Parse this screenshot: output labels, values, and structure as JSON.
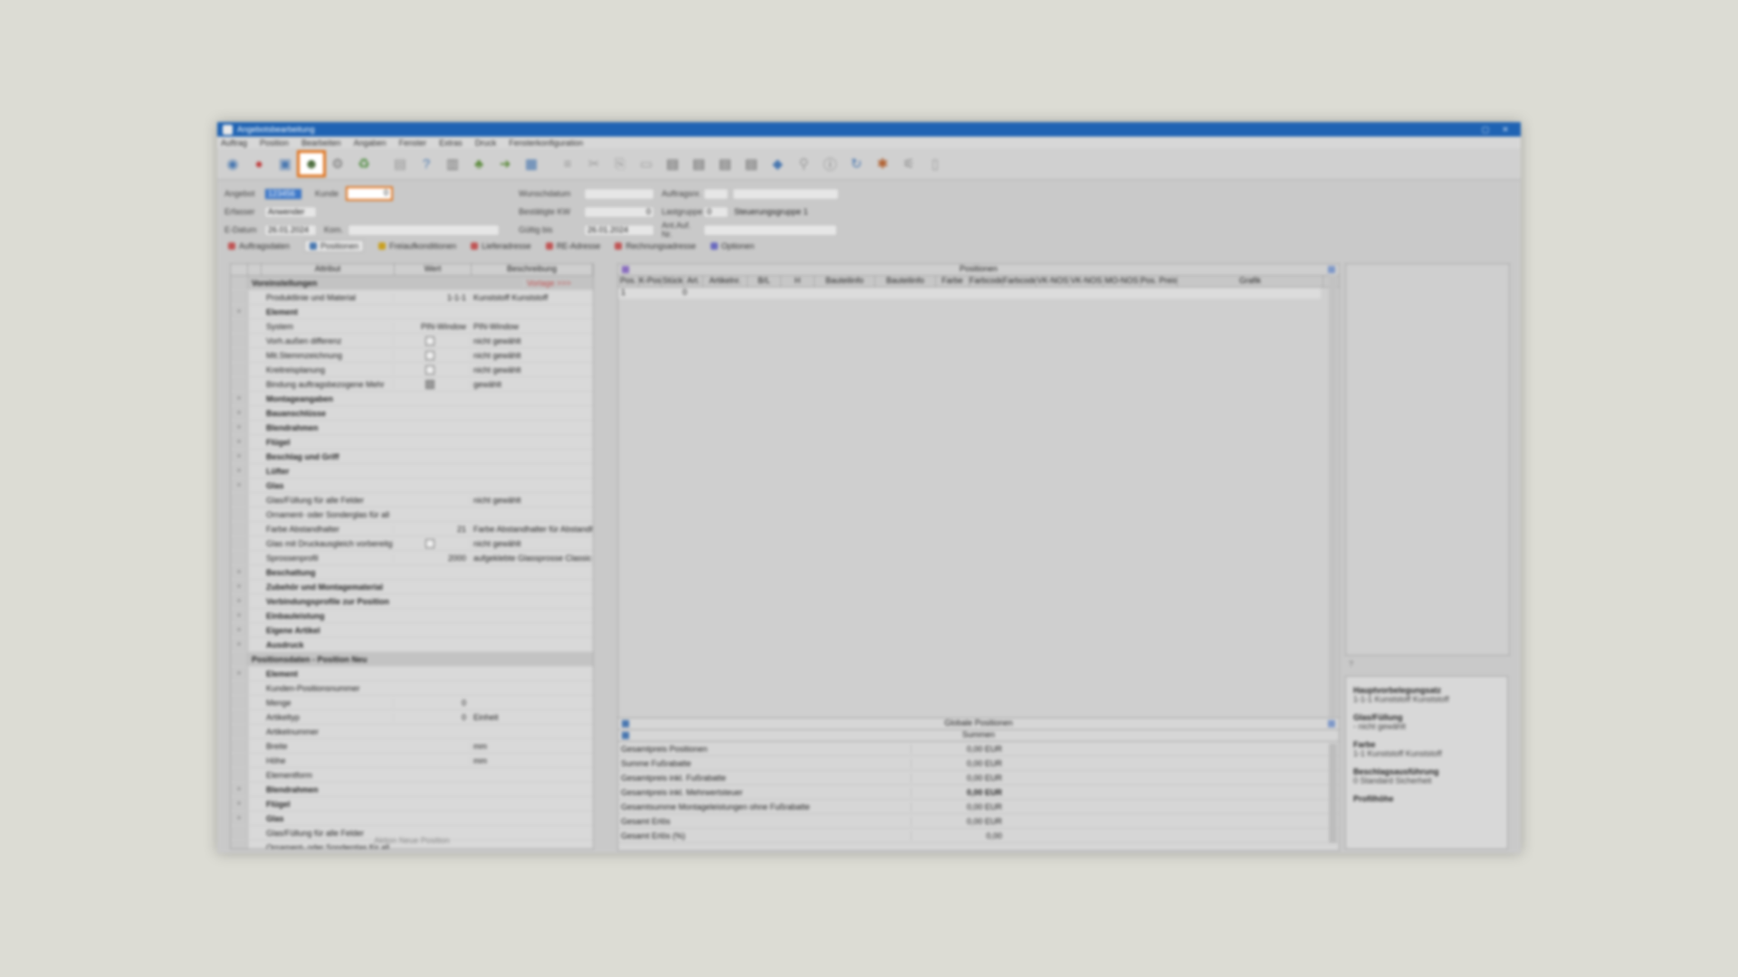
{
  "window": {
    "title": "Angebotsbearbeitung"
  },
  "menu": [
    "Auftrag",
    "Position",
    "Bearbeiten",
    "Angaben",
    "Fenster",
    "Extras",
    "Druck",
    "Fensterkonfiguration"
  ],
  "toolbar": {
    "icons": [
      "globe-icon",
      "stop-icon",
      "save-icon",
      "person-money-icon",
      "gear-icon",
      "recycle-icon",
      "document-icon",
      "help-icon",
      "book-icon",
      "people-icon",
      "arrow-icon",
      "calendar-icon",
      "list-icon",
      "cut-icon",
      "copy-icon",
      "paste-icon",
      "print-icon",
      "print2-icon",
      "print3-icon",
      "print4-icon",
      "globe2-icon",
      "link-icon",
      "info-icon",
      "refresh-icon",
      "tools-icon",
      "filter-icon",
      "document2-icon"
    ]
  },
  "form": {
    "angebot_label": "Angebot",
    "angebot_value": "123456",
    "kunde_label": "Kunde",
    "kunde_value": "0",
    "erfasser_label": "Erfasser",
    "erfasser_value": "Anwender",
    "datum_label": "E-Datum",
    "datum_value": "26.01.2024",
    "kom_label": "Kom.",
    "kom_value": "",
    "wunschdatum_label": "Wunschdatum",
    "wunschdatum_value": "",
    "auftragsnr_label": "Auftragsnr.",
    "auftragsnr_value": "",
    "bestaetigte_label": "Bestätigte KW",
    "bestaetigte_value": "0",
    "lastgruppe_label": "Lastgruppe",
    "lastgruppe_value": "0",
    "lastgruppe_text": "Steuerungsgruppe 1",
    "gueltig_label": "Gültig bis",
    "gueltig_value": "26.01.2024",
    "ansachb_label": "Ant.Auf. Nr.",
    "ansachb_value": ""
  },
  "tabs": [
    "Auftragsdaten",
    "Positionen",
    "Freiaufkonditionen",
    "Lieferadresse",
    "RE-Adresse",
    "Rechnungsadresse",
    "Optionen"
  ],
  "left_table": {
    "headers": [
      "",
      "Attribut",
      "Wert",
      "Beschreibung"
    ],
    "rows": [
      {
        "type": "group",
        "c1": "Voreinstellungen",
        "c2": "",
        "c3": "Vorlage >>>"
      },
      {
        "type": "sub",
        "c1": "Produktlinie und Material",
        "c2": "1-1-1",
        "c3": "Kunststoff Kunststoff"
      },
      {
        "type": "bold",
        "c1": "Element",
        "c2": "",
        "c3": ""
      },
      {
        "type": "sub",
        "c1": "System",
        "c2": "PIN-Window",
        "c3": "PIN-Window"
      },
      {
        "type": "sub",
        "c1": "Vorh.außen differenz",
        "c2": "[cb]",
        "c3": "nicht gewählt"
      },
      {
        "type": "sub",
        "c1": "Mit.Stemmzeichnung",
        "c2": "[cb]",
        "c3": "nicht gewählt"
      },
      {
        "type": "sub",
        "c1": "Kreitreisplanung",
        "c2": "[cb]",
        "c3": "nicht gewählt"
      },
      {
        "type": "sub",
        "c1": "Bindung auftragsbezogene Mehr",
        "c2": "[cbon]",
        "c3": "gewählt"
      },
      {
        "type": "bold",
        "c1": "Montageangaben",
        "c2": "",
        "c3": ""
      },
      {
        "type": "bold",
        "c1": "Bauanschlüsse",
        "c2": "",
        "c3": ""
      },
      {
        "type": "bold",
        "c1": "Blendrahmen",
        "c2": "",
        "c3": ""
      },
      {
        "type": "bold",
        "c1": "Flügel",
        "c2": "",
        "c3": ""
      },
      {
        "type": "bold",
        "c1": "Beschlag und Griff",
        "c2": "",
        "c3": ""
      },
      {
        "type": "bold",
        "c1": "Lüfter",
        "c2": "",
        "c3": ""
      },
      {
        "type": "bold",
        "c1": "Glas",
        "c2": "",
        "c3": ""
      },
      {
        "type": "sub",
        "c1": "Glas/Füllung für alle Felder",
        "c2": "",
        "c3": "nicht gewählt"
      },
      {
        "type": "sub",
        "c1": "Ornament- oder Sonderglas für all",
        "c2": "",
        "c3": ""
      },
      {
        "type": "sub",
        "c1": "Farbe Abstandhalter",
        "c2": "21",
        "c3": "Farbe Abstandhalter für Abstandhalter Fe"
      },
      {
        "type": "sub",
        "c1": "Glas mit Druckausgleich vorbereitg",
        "c2": "[cb]",
        "c3": "nicht gewählt"
      },
      {
        "type": "sub",
        "c1": "Sprossenprofil",
        "c2": "2000",
        "c3": "aufgeklebte Glassprosse Classic 18 m"
      },
      {
        "type": "bold",
        "c1": "Beschattung",
        "c2": "",
        "c3": ""
      },
      {
        "type": "bold",
        "c1": "Zubehör und Montagematerial",
        "c2": "",
        "c3": ""
      },
      {
        "type": "bold",
        "c1": "Verbindungsprofile zur Position",
        "c2": "",
        "c3": ""
      },
      {
        "type": "bold",
        "c1": "Einbauleistung",
        "c2": "",
        "c3": ""
      },
      {
        "type": "bold",
        "c1": "Eigene Artikel",
        "c2": "",
        "c3": ""
      },
      {
        "type": "bold",
        "c1": "Ausdruck",
        "c2": "",
        "c3": ""
      },
      {
        "type": "group",
        "c1": "Positionsdaten - Position Neu",
        "c2": "",
        "c3": ""
      },
      {
        "type": "bold",
        "c1": "Element",
        "c2": "",
        "c3": ""
      },
      {
        "type": "sub",
        "c1": "Kunden-Positionsnummer",
        "c2": "",
        "c3": ""
      },
      {
        "type": "sub",
        "c1": "Menge",
        "c2": "0",
        "c3": ""
      },
      {
        "type": "sub",
        "c1": "Artikeltyp",
        "c2": "0",
        "c3": "Einheit"
      },
      {
        "type": "sub",
        "c1": "Artikelnummer",
        "c2": "",
        "c3": ""
      },
      {
        "type": "sub",
        "c1": "Breite",
        "c2": "",
        "c3": "mm"
      },
      {
        "type": "sub",
        "c1": "Höhe",
        "c2": "",
        "c3": "mm"
      },
      {
        "type": "sub",
        "c1": "Elementform",
        "c2": "",
        "c3": ""
      },
      {
        "type": "bold",
        "c1": "Blendrahmen",
        "c2": "",
        "c3": ""
      },
      {
        "type": "bold",
        "c1": "Flügel",
        "c2": "",
        "c3": ""
      },
      {
        "type": "bold",
        "c1": "Glas",
        "c2": "",
        "c3": ""
      },
      {
        "type": "sub",
        "c1": "Glas/Füllung für alle Felder",
        "c2": "",
        "c3": ""
      },
      {
        "type": "sub",
        "c1": "Ornament- oder Sonderglas für all",
        "c2": "",
        "c3": ""
      }
    ],
    "footer": "Aktion   Neue Position"
  },
  "positions": {
    "title": "Positionen",
    "headers": [
      "Pos.",
      "K-Pos.",
      "Stück",
      "Art.",
      "Artikelnr.",
      "B/L",
      "H",
      "Bauteilinfo",
      "Bauteilinfo",
      "Farbe",
      "Farbcode",
      "Farbcode",
      "VK-NOS",
      "VK-NOS",
      "MO-NOS",
      "Pos. Preis",
      "Grafik"
    ],
    "row": [
      "1",
      "",
      "0"
    ]
  },
  "summary": {
    "title": "Globale Positionen",
    "subtitle": "Summen",
    "rows": [
      {
        "label": "Gesamtpreis Positionen",
        "value": "0,00 EUR",
        "bold": false
      },
      {
        "label": "Summe Fußrabatte",
        "value": "0,00 EUR",
        "bold": false
      },
      {
        "label": "Gesamtpreis inkl. Fußrabatte",
        "value": "0,00 EUR",
        "bold": false
      },
      {
        "label": "Gesamtpreis inkl. Mehrwertsteuer",
        "value": "0,00 EUR",
        "bold": true
      },
      {
        "label": "Gesamtsumme Montageleistungen ohne Fußrabatte",
        "value": "0,00 EUR",
        "bold": false
      },
      {
        "label": "Gesamt Erlös",
        "value": "0,00 EUR",
        "bold": false
      },
      {
        "label": "Gesamt Erlös (%)",
        "value": "0,00",
        "bold": false
      }
    ]
  },
  "right_info": [
    {
      "title": "Hauptvorbelegungsatz",
      "value": "1-1-1  Kunststoff Kunststoff"
    },
    {
      "title": "Glas/Füllung",
      "value": "-       nicht gewählt"
    },
    {
      "title": "Farbe",
      "value": "1-1    Kunststoff Kunststoff"
    },
    {
      "title": "Beschlagsausführung",
      "value": "0       Standard Sicherheit"
    },
    {
      "title": "Profilhöhe",
      "value": ""
    }
  ],
  "help_mark": "?"
}
